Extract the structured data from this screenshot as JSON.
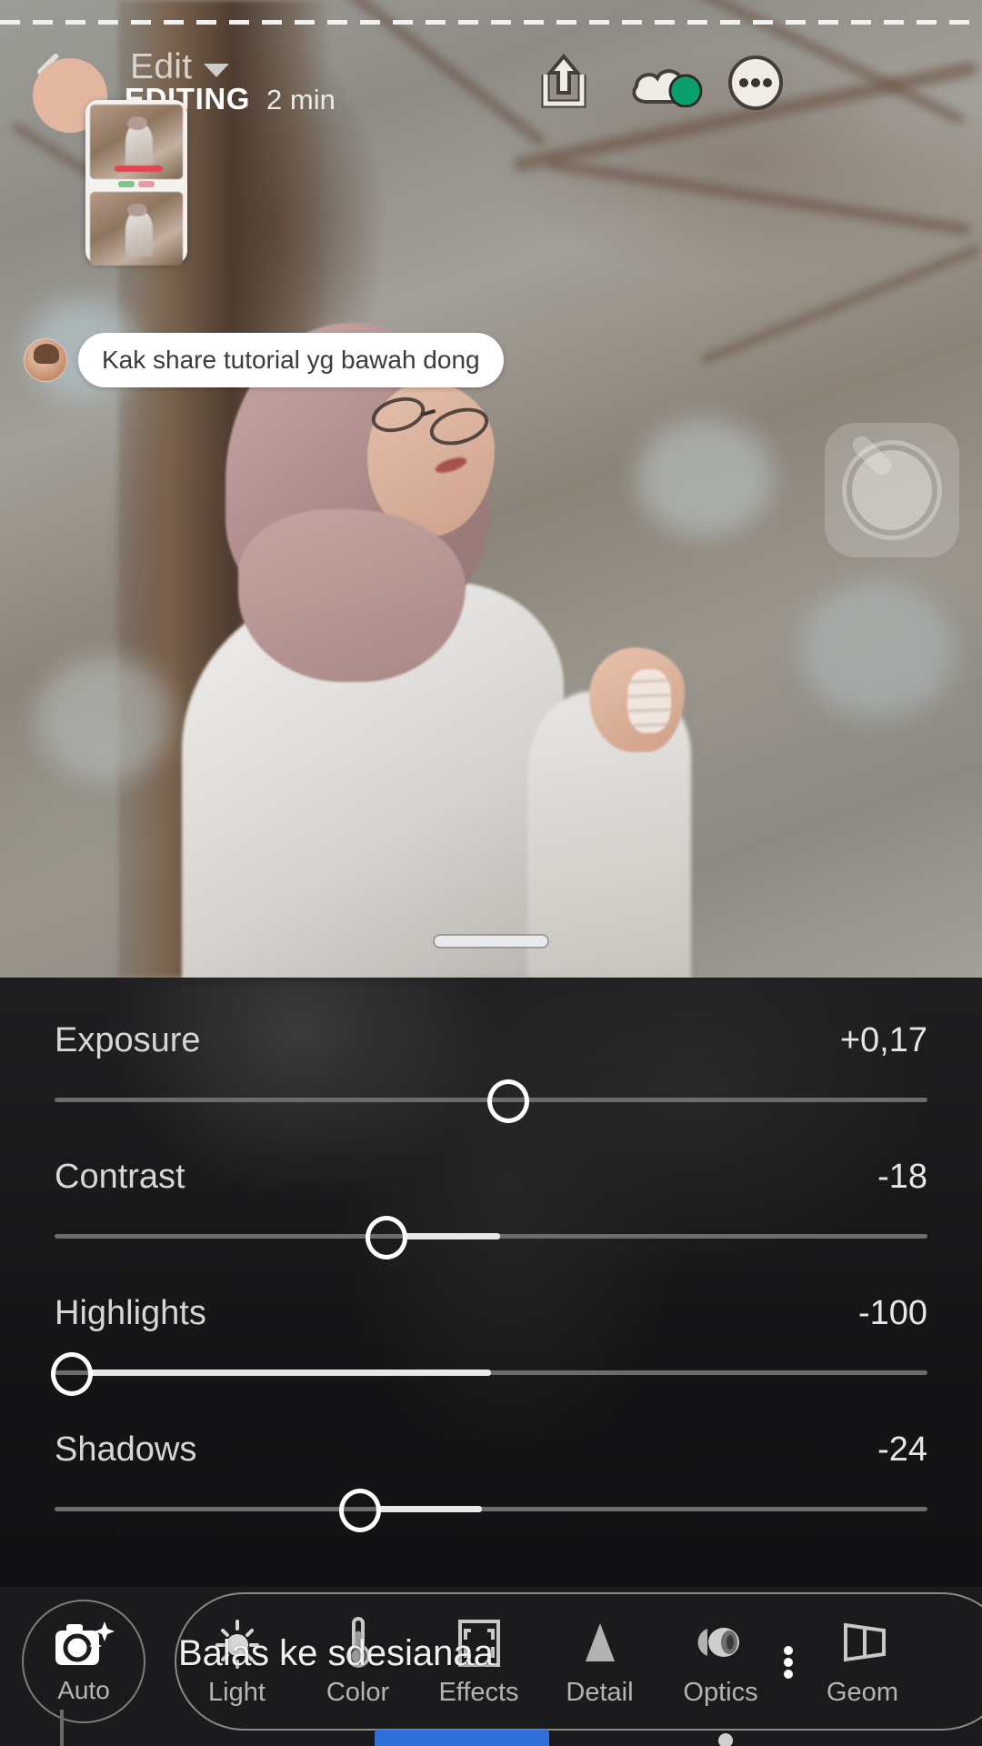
{
  "header": {
    "back_icon": "back-arrow-icon",
    "avatar": "user-avatar",
    "edit_label": "Edit",
    "caret_icon": "chevron-down-icon",
    "status_text": "EDITING",
    "status_time": "2 min",
    "share_icon": "share-export-icon",
    "cloud_icon": "cloud-sync-icon",
    "cloud_badge_color": "#0aa06e",
    "more_icon": "more-options-icon"
  },
  "overlay": {
    "thumbnail_card": "shared-post-thumbnail",
    "comment": {
      "avatar": "commenter-avatar",
      "text": "Kak share tutorial yg bawah dong"
    },
    "shutter": "camera-shutter-overlay",
    "drag_handle": "panel-drag-handle"
  },
  "panel": {
    "sliders": [
      {
        "name": "Exposure",
        "value": "+0,17",
        "knob_pct": 52,
        "fill_from": 52,
        "fill_to": 52
      },
      {
        "name": "Contrast",
        "value": "-18",
        "knob_pct": 38,
        "fill_from": 42,
        "fill_to": 50
      },
      {
        "name": "Highlights",
        "value": "-100",
        "knob_pct": 2,
        "fill_from": 5,
        "fill_to": 50
      },
      {
        "name": "Shadows",
        "value": "-24",
        "knob_pct": 35,
        "fill_from": 39,
        "fill_to": 48
      }
    ]
  },
  "bottom_bar": {
    "auto": {
      "label": "Auto",
      "icon": "auto-camera-icon"
    },
    "tools": [
      {
        "label": "Light",
        "icon": "sun-light-icon"
      },
      {
        "label": "Color",
        "icon": "thermometer-color-icon"
      },
      {
        "label": "Effects",
        "icon": "effects-frame-icon"
      },
      {
        "label": "Detail",
        "icon": "detail-triangle-icon"
      },
      {
        "label": "Optics",
        "icon": "optics-lens-icon"
      },
      {
        "label": "Geom",
        "icon": "geometry-icon"
      }
    ],
    "overflow_icon": "vertical-dots-icon"
  },
  "reply_overlay": {
    "text": "Balas ke sdesianaa"
  },
  "colors": {
    "panel_bg": "#1b1b1d",
    "accent_blue": "#2f6fd8",
    "slider_track": "#6d6c6a",
    "slider_fill": "#e9e8e6",
    "text_primary": "#e8e6e3",
    "text_secondary": "#b6b4b1"
  }
}
